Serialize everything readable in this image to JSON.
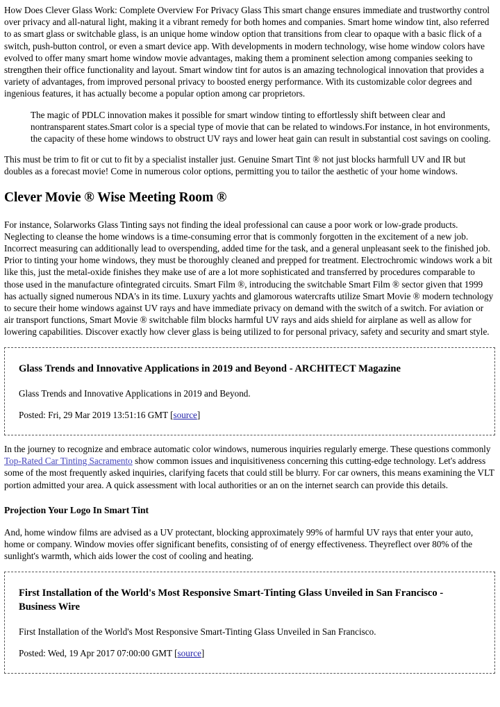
{
  "article": {
    "intro_paragraph": "How Does Clever Glass Work: Complete Overview For Privacy Glass This smart change ensures immediate and trustworthy control over privacy and all-natural light, making it a vibrant remedy for both homes and companies. Smart home window tint, also referred to as smart glass or switchable glass, is an unique home window option that transitions from clear to opaque with a basic flick of a switch, push-button control, or even a smart device app. With developments in modern technology, wise home window colors have evolved to offer many smart home window movie advantages, making them a prominent selection among companies seeking to strengthen their office functionality and layout. Smart window tint for autos is an amazing technological innovation that provides a variety of advantages, from improved personal privacy to boosted energy performance. With its customizable color degrees and ingenious features, it has actually become a popular option among car proprietors.",
    "blockquote": "The magic of PDLC innovation makes it possible for smart window tinting to effortlessly shift between clear and nontransparent states.Smart color is a special type of movie that can be related to windows.For instance, in hot environments, the capacity of these home windows to obstruct UV rays and lower heat gain can result in substantial cost savings on cooling.",
    "paragraph_after_quote": "This must be trim to fit or cut to fit by a specialist installer just. Genuine Smart Tint ® not just blocks harmfull UV and IR but doubles as a forecast movie! Come in numerous color options, permitting you to tailor the aesthetic of your home windows.",
    "section_heading": "Clever Movie ® Wise Meeting Room ®",
    "long_paragraph": "For instance, Solarworks Glass Tinting says not finding the ideal professional can cause a poor work or low-grade products. Neglecting to cleanse the home windows is a time-consuming error that is commonly forgotten in the excitement of a new job. Incorrect measuring can additionally lead to overspending, added time for the task, and a general unpleasant seek to the finished job. Prior to tinting your home windows, they must be thoroughly cleaned and prepped for treatment. Electrochromic windows work a bit like this, just the metal-oxide finishes they make use of are a lot more sophisticated and transferred by procedures comparable to those used in the manufacture ofintegrated circuits. Smart Film ®, introducing the switchable Smart Film ® sector given that 1999 has actually signed numerous NDA's in its time. Luxury yachts and glamorous watercrafts utilize Smart Movie ® modern technology to secure their home windows against UV rays and have immediate privacy on demand with the switch of a switch. For aviation or air transport functions, Smart Movie ® switchable film blocks harmful UV rays and aids shield for airplane as well as allow for lowering capabilities. Discover exactly how clever glass is being utilized to for personal privacy, safety and security and smart style.",
    "faq_paragraph_before_link": "In the journey to recognize and embrace automatic color windows, numerous inquiries regularly emerge. These questions commonly ",
    "faq_inline_link": "Top-Rated Car Tinting Sacramento",
    "faq_paragraph_after_link": " show common issues and inquisitiveness concerning this cutting-edge technology. Let's address some of the most frequently asked inquiries, clarifying facets that could still be blurry. For car owners, this means examining the VLT portion admitted your area. A quick assessment with local authorities or an on the internet search can provide this details.",
    "projection_heading": "Projection Your Logo In Smart Tint",
    "projection_paragraph": "And, home window films are advised as a UV protectant, blocking approximately 99% of harmful UV rays that enter your auto, home or company. Window movies offer significant benefits, consisting of of energy effectiveness. Theyreflect over 80% of the sunlight's warmth, which aids lower the cost of cooling and heating."
  },
  "news_items": [
    {
      "title": "Glass Trends and Innovative Applications in 2019 and Beyond - ARCHITECT Magazine",
      "description": "Glass Trends and Innovative Applications in 2019 and Beyond.",
      "posted_prefix": "Posted: Fri, 29 Mar 2019 13:51:16 GMT [",
      "source_label": "source",
      "posted_suffix": "]"
    },
    {
      "title": "First Installation of the World's Most Responsive Smart-Tinting Glass Unveiled in San Francisco - Business Wire",
      "description": "First Installation of the World's Most Responsive Smart-Tinting Glass Unveiled in San Francisco.",
      "posted_prefix": "Posted: Wed, 19 Apr 2017 07:00:00 GMT [",
      "source_label": "source",
      "posted_suffix": "]"
    }
  ],
  "colors": {
    "link": "#2222aa",
    "inline_link": "#4444bb",
    "text": "#000000",
    "box_border": "#555555",
    "background": "#ffffff"
  }
}
